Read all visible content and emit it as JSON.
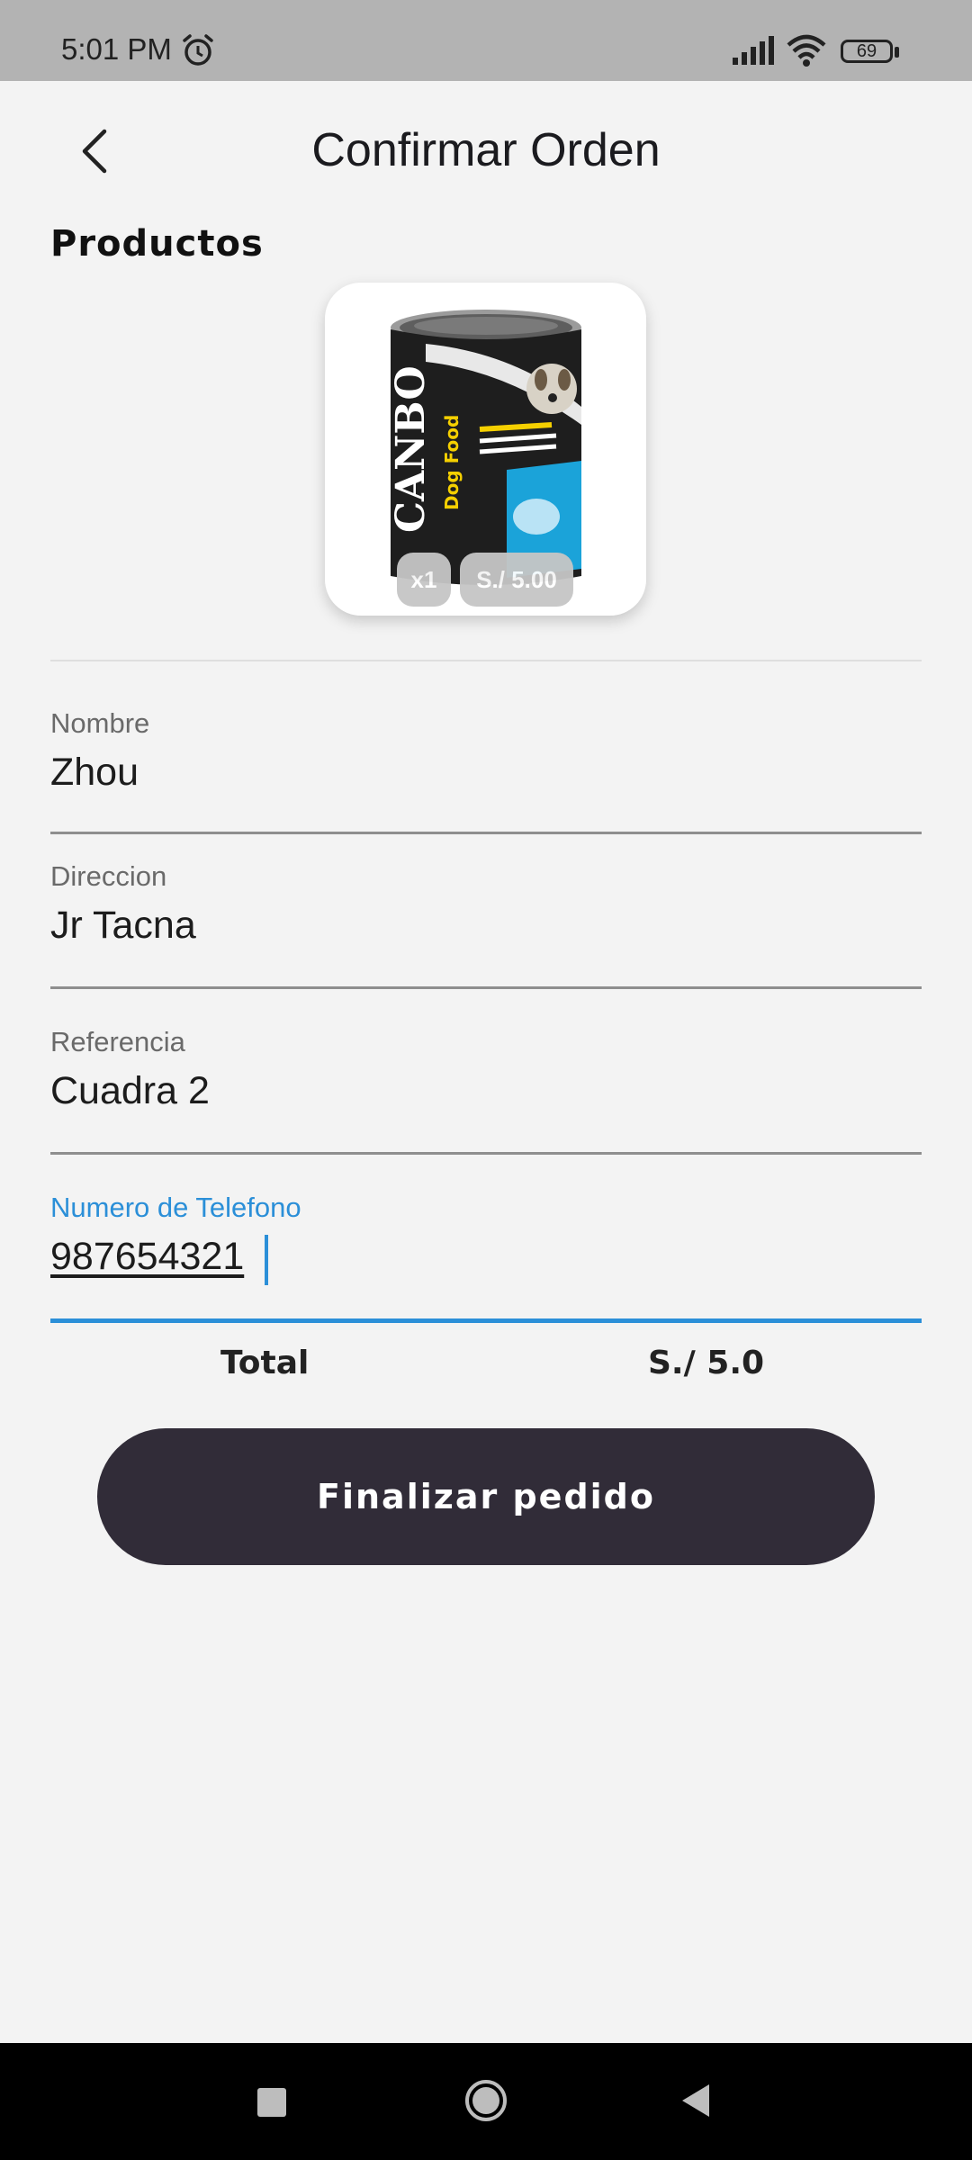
{
  "status_bar": {
    "time": "5:01 PM",
    "battery": "69"
  },
  "header": {
    "title": "Confirmar Orden"
  },
  "products": {
    "section_title": "Productos",
    "items": [
      {
        "image_name": "canbo-dog-food-can",
        "quantity": "x1",
        "price": "S./ 5.00"
      }
    ]
  },
  "form": {
    "nombre": {
      "label": "Nombre",
      "value": "Zhou"
    },
    "direccion": {
      "label": "Direccion",
      "value": "Jr Tacna"
    },
    "referencia": {
      "label": "Referencia",
      "value": "Cuadra 2"
    },
    "telefono": {
      "label": "Numero de Telefono",
      "value": "987654321"
    }
  },
  "total": {
    "label": "Total",
    "value": "S./ 5.0"
  },
  "actions": {
    "finalize_label": "Finalizar pedido"
  },
  "colors": {
    "accent": "#2b8fd8",
    "button": "#312c38",
    "background": "#f3f3f3"
  }
}
